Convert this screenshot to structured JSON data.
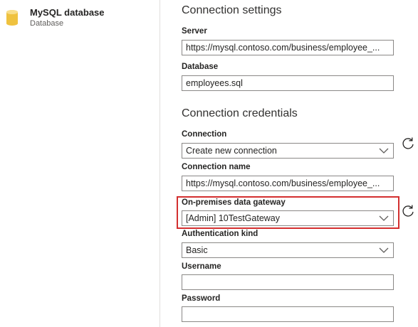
{
  "source": {
    "name": "MySQL database",
    "type": "Database"
  },
  "settings": {
    "title": "Connection settings",
    "server_label": "Server",
    "server_value": "https://mysql.contoso.com/business/employee_...",
    "database_label": "Database",
    "database_value": "employees.sql"
  },
  "credentials": {
    "title": "Connection credentials",
    "connection_label": "Connection",
    "connection_value": "Create new connection",
    "connection_name_label": "Connection name",
    "connection_name_value": "https://mysql.contoso.com/business/employee_...",
    "gateway_label": "On-premises data gateway",
    "gateway_value": "[Admin] 10TestGateway",
    "auth_label": "Authentication kind",
    "auth_value": "Basic",
    "username_label": "Username",
    "username_value": "",
    "password_label": "Password",
    "password_value": ""
  },
  "colors": {
    "highlight": "#d32f2f",
    "db_icon": "#f2c94c"
  }
}
